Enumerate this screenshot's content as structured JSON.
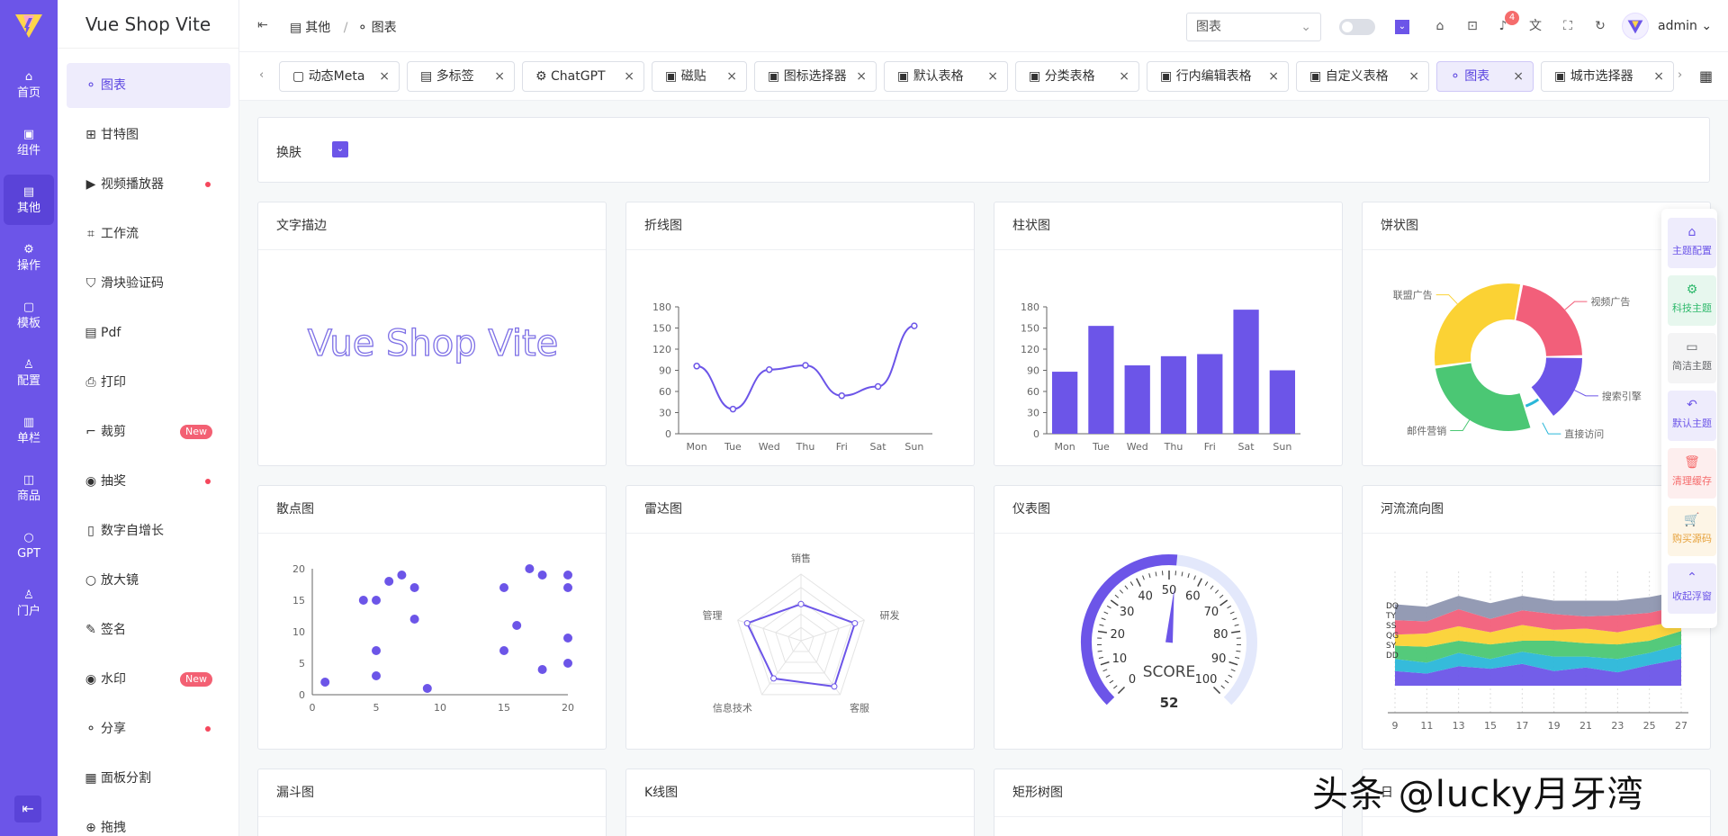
{
  "rail": {
    "items": [
      {
        "label": "首页",
        "icon": "home-icon"
      },
      {
        "label": "组件",
        "icon": "image-icon"
      },
      {
        "label": "其他",
        "icon": "archive-icon",
        "active": true
      },
      {
        "label": "操作",
        "icon": "operation-icon"
      },
      {
        "label": "模板",
        "icon": "template-icon"
      },
      {
        "label": "配置",
        "icon": "user-config-icon"
      },
      {
        "label": "单栏",
        "icon": "column-icon"
      },
      {
        "label": "商品",
        "icon": "goods-icon"
      },
      {
        "label": "GPT",
        "icon": "chat-icon"
      },
      {
        "label": "门户",
        "icon": "portal-icon"
      }
    ],
    "collapse_icon": "collapse-icon"
  },
  "sidebar": {
    "brand": "Vue Shop Vite",
    "items": [
      {
        "label": "图表",
        "icon": "share-icon",
        "active": true,
        "mark": ""
      },
      {
        "label": "甘特图",
        "icon": "gantt-icon",
        "mark": ""
      },
      {
        "label": "视频播放器",
        "icon": "video-icon",
        "mark": "dot"
      },
      {
        "label": "工作流",
        "icon": "workflow-icon",
        "mark": ""
      },
      {
        "label": "滑块验证码",
        "icon": "shield-icon",
        "mark": ""
      },
      {
        "label": "Pdf",
        "icon": "file-icon",
        "mark": ""
      },
      {
        "label": "打印",
        "icon": "printer-icon",
        "mark": ""
      },
      {
        "label": "裁剪",
        "icon": "crop-icon",
        "mark": "new"
      },
      {
        "label": "抽奖",
        "icon": "award-icon",
        "mark": "dot"
      },
      {
        "label": "数字自增长",
        "icon": "counter-icon",
        "mark": ""
      },
      {
        "label": "放大镜",
        "icon": "magnifier-icon",
        "mark": ""
      },
      {
        "label": "签名",
        "icon": "pen-icon",
        "mark": ""
      },
      {
        "label": "水印",
        "icon": "watermark-icon",
        "mark": "new"
      },
      {
        "label": "分享",
        "icon": "share-icon",
        "mark": "dot"
      },
      {
        "label": "面板分割",
        "icon": "panel-icon",
        "mark": ""
      },
      {
        "label": "拖拽",
        "icon": "drag-icon",
        "mark": ""
      }
    ],
    "new_label": "New"
  },
  "topbar": {
    "breadcrumb": [
      "其他",
      "/",
      "图表"
    ],
    "search_value": "图表",
    "switch_label": "",
    "notification_count": "4",
    "username": "admin"
  },
  "tabs": [
    {
      "label": "动态Meta"
    },
    {
      "label": "多标签"
    },
    {
      "label": "ChatGPT"
    },
    {
      "label": "磁贴"
    },
    {
      "label": "图标选择器"
    },
    {
      "label": "默认表格"
    },
    {
      "label": "分类表格"
    },
    {
      "label": "行内编辑表格"
    },
    {
      "label": "自定义表格"
    },
    {
      "label": "图表",
      "active": true
    },
    {
      "label": "城市选择器"
    }
  ],
  "skin": {
    "label": "换肤"
  },
  "cards": {
    "text_stroke": {
      "title": "文字描边",
      "text": "Vue Shop Vite"
    },
    "line": {
      "title": "折线图"
    },
    "bar": {
      "title": "柱状图"
    },
    "pie": {
      "title": "饼状图"
    },
    "scatter": {
      "title": "散点图"
    },
    "radar": {
      "title": "雷达图"
    },
    "gauge": {
      "title": "仪表图"
    },
    "river": {
      "title": "河流流向图"
    },
    "funnel": {
      "title": "漏斗图"
    },
    "kline": {
      "title": "K线图"
    },
    "treemap": {
      "title": "矩形树图"
    },
    "last": {
      "title": "日"
    }
  },
  "float_panel": [
    {
      "label": "主题配置",
      "color": "#6c55e8",
      "bg": "#eeecfc"
    },
    {
      "label": "科技主题",
      "color": "#2fb96c",
      "bg": "#e7f7ee"
    },
    {
      "label": "简洁主题",
      "color": "#606266",
      "bg": "#f4f4f5"
    },
    {
      "label": "默认主题",
      "color": "#6c55e8",
      "bg": "#eeecfc"
    },
    {
      "label": "清理缓存",
      "color": "#f56c6c",
      "bg": "#fdeeee"
    },
    {
      "label": "购买源码",
      "color": "#e6a23c",
      "bg": "#fdf5e6"
    },
    {
      "label": "收起浮窗",
      "color": "#6c55e8",
      "bg": "#eeecfc"
    }
  ],
  "watermark": "头条 @lucky月牙湾",
  "chart_data": [
    {
      "type": "line",
      "categories": [
        "Mon",
        "Tue",
        "Wed",
        "Thu",
        "Fri",
        "Sat",
        "Sun"
      ],
      "values": [
        96,
        35,
        91,
        97,
        54,
        67,
        153
      ],
      "ylim": [
        0,
        180
      ],
      "yticks": [
        0,
        30,
        60,
        90,
        120,
        150,
        180
      ],
      "color": "#6c55e8"
    },
    {
      "type": "bar",
      "categories": [
        "Mon",
        "Tue",
        "Wed",
        "Thu",
        "Fri",
        "Sat",
        "Sun"
      ],
      "values": [
        88,
        153,
        97,
        110,
        113,
        176,
        90
      ],
      "ylim": [
        0,
        180
      ],
      "yticks": [
        0,
        30,
        60,
        90,
        120,
        150,
        180
      ],
      "color": "#6c55e8"
    },
    {
      "type": "pie",
      "categories": [
        "视频广告",
        "搜索引擎",
        "直接访问",
        "邮件营销",
        "联盟广告"
      ],
      "values": [
        22,
        15,
        5,
        28,
        30
      ],
      "colors": [
        "#f25f7a",
        "#6c55e8",
        "#2ab7d9",
        "#4bc774",
        "#fbd234"
      ]
    },
    {
      "type": "scatter",
      "x": [
        1,
        4,
        5,
        5,
        5,
        6,
        7,
        8,
        8,
        9,
        15,
        15,
        16,
        17,
        18,
        18,
        20,
        20,
        20,
        20
      ],
      "y": [
        2,
        15,
        15,
        7,
        3,
        18,
        19,
        17,
        12,
        1,
        17,
        7,
        11,
        20,
        19,
        4,
        19,
        17,
        9,
        5
      ],
      "xlim": [
        0,
        20
      ],
      "ylim": [
        0,
        20
      ],
      "xticks": [
        0,
        5,
        10,
        15,
        20
      ],
      "yticks": [
        0,
        5,
        10,
        15,
        20
      ],
      "color": "#6c55e8"
    },
    {
      "type": "radar",
      "categories": [
        "销售",
        "研发",
        "客服",
        "信息技术",
        "管理"
      ],
      "values": [
        0.55,
        0.85,
        0.85,
        0.7,
        0.85
      ],
      "color": "#6c55e8"
    },
    {
      "type": "gauge",
      "value": 52,
      "min": 0,
      "max": 100,
      "ticks": [
        0,
        10,
        20,
        30,
        40,
        50,
        60,
        70,
        80,
        90,
        100
      ],
      "label": "SCORE",
      "color": "#6c55e8"
    },
    {
      "type": "area",
      "x": [
        9,
        11,
        13,
        15,
        17,
        19,
        21,
        23,
        25,
        27
      ],
      "series_labels": [
        "DQ",
        "TY",
        "SS",
        "QG",
        "SY",
        "DD"
      ],
      "colors": [
        "#6c55e8",
        "#2ab7d9",
        "#4bc774",
        "#fbd234",
        "#f25f7a",
        "#8e96b0"
      ]
    }
  ]
}
